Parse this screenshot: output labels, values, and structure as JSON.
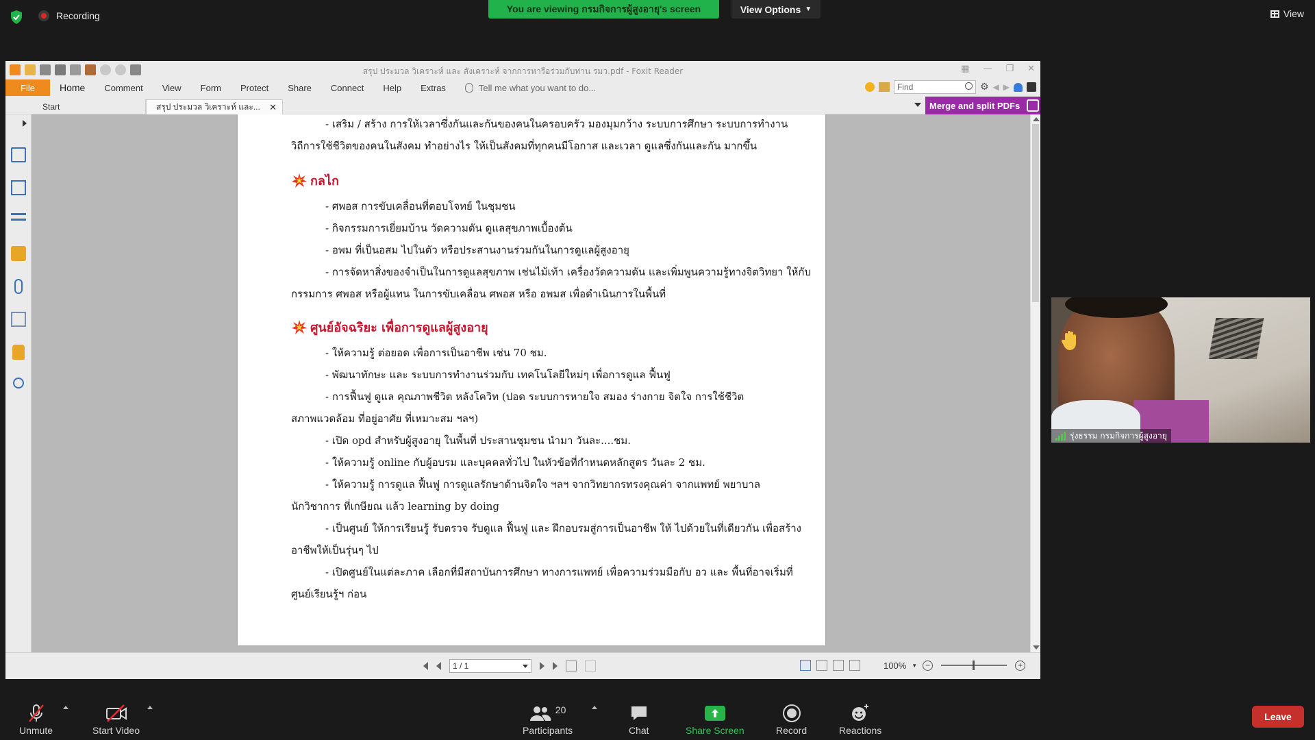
{
  "topbar": {
    "recording": "Recording",
    "viewing_banner": "You are viewing กรมกิจการผู้สูงอายุ's screen",
    "view_options": "View Options",
    "view": "View"
  },
  "foxit": {
    "window_title": "สรุป ประมวล วิเคราะห์ และ สังเคราะห์ จากการหารือร่วมกับท่าน รมว.pdf - Foxit Reader",
    "menu": [
      "Home",
      "Comment",
      "View",
      "Form",
      "Protect",
      "Share",
      "Connect",
      "Help",
      "Extras"
    ],
    "file_tab": "File",
    "tell_me": "Tell me what you want to do...",
    "find_placeholder": "Find",
    "tabs": {
      "start": "Start",
      "doc": "สรุป ประมวล วิเคราะห์ และ..."
    },
    "merge_label": "Merge and split PDFs",
    "page_indicator": "1 / 1",
    "zoom": "100%"
  },
  "document": {
    "lines_top": [
      "- เสริม / สร้าง การให้เวลาซึ่งกันและกันของคนในครอบครัว มองมุมกว้าง ระบบการศึกษา ระบบการทำงาน",
      "วิถีการใช้ชีวิตของคนในสังคม ทำอย่างไร ให้เป็นสังคมที่ทุกคนมีโอกาส และเวลา ดูแลซึ่งกันและกัน มากขึ้น"
    ],
    "heading1": "กลไก",
    "lines_mid": [
      "- ศพอส การขับเคลื่อนที่ตอบโจทย์ ในชุมชน",
      "- กิจกรรมการเยี่ยมบ้าน วัดความดัน ดูแลสุขภาพเบื้องต้น",
      "- อพม ที่เป็นอสม ไปในตัว หรือประสานงานร่วมกันในการดูแลผู้สูงอายุ",
      "- การจัดหาสิ่งของจำเป็นในการดูแลสุขภาพ เช่นไม้เท้า เครื่องวัดความดัน และเพิ่มพูนความรู้ทางจิตวิทยา ให้กับ",
      "กรรมการ ศพอส หรือผู้แทน ในการขับเคลื่อน ศพอส หรือ อพมส เพื่อดำเนินการในพื้นที่"
    ],
    "heading2": "ศูนย์อัจฉริยะ เพื่อการดูแลผู้สูงอายุ",
    "lines_bottom": [
      "- ให้ความรู้ ต่อยอด เพื่อการเป็นอาชีพ เช่น 70 ชม.",
      "- พัฒนาทักษะ และ ระบบการทำงานร่วมกับ เทคโนโลยีใหม่ๆ เพื่อการดูแล ฟื้นฟู",
      "- การฟื้นฟู ดูแล คุณภาพชีวิต หลังโควิท (ปอด ระบบการหายใจ สมอง ร่างกาย จิตใจ การใช้ชีวิต",
      "สภาพแวดล้อม ที่อยู่อาศัย ที่เหมาะสม ฯลฯ)",
      "- เปิด opd สำหรับผู้สูงอายุ ในพื้นที่ ประสานชุมชน นำมา วันละ....ชม.",
      "- ให้ความรู้ online กับผู้อบรม และบุคคลทั่วไป ในหัวข้อที่กำหนดหลักสูตร วันละ 2 ชม.",
      "- ให้ความรู้ การดูแล ฟื้นฟู การดูแลรักษาด้านจิตใจ ฯลฯ จากวิทยากรทรงคุณค่า จากแพทย์ พยาบาล",
      "นักวิชาการ ที่เกษียณ แล้ว learning by doing",
      "- เป็นศูนย์ ให้การเรียนรู้ รับตรวจ รับดูแล ฟื้นฟู และ ฝึกอบรมสู่การเป็นอาชีพ ให้ ไปด้วยในที่เดียวกัน เพื่อสร้าง",
      "อาชีพให้เป็นรุ่นๆ ไป",
      "- เปิดศูนย์ในแต่ละภาค เลือกที่มีสถาบันการศึกษา ทางการแพทย์ เพื่อความร่วมมือกับ อว และ พื้นที่อาจเริ่มที่",
      "ศูนย์เรียนรู้ฯ ก่อน"
    ]
  },
  "participant": {
    "name": "รุ่งธรรม กรมกิจการผู้สูงอายุ"
  },
  "toolbar": {
    "unmute": "Unmute",
    "start_video": "Start Video",
    "participants": "Participants",
    "participants_count": "20",
    "chat": "Chat",
    "share_screen": "Share Screen",
    "record": "Record",
    "reactions": "Reactions",
    "leave": "Leave"
  },
  "colors": {
    "viewing_green": "#22b24c",
    "file_orange": "#ef8a1e",
    "merge_purple": "#9a2aa6",
    "heading_red": "#c5182f",
    "leave_red": "#c5302c"
  }
}
